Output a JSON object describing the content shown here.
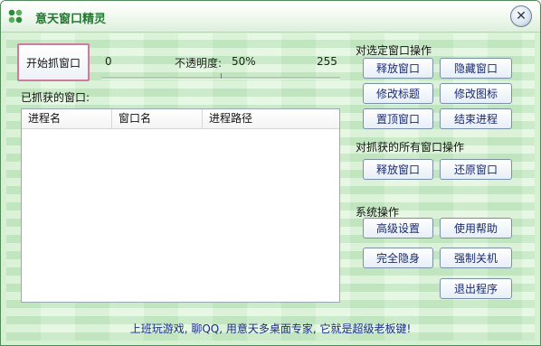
{
  "window": {
    "title": "意天窗口精灵",
    "close_glyph": "✕"
  },
  "capture": {
    "start_button": "开始抓窗口"
  },
  "opacity": {
    "min": "0",
    "label": "不透明度:",
    "value": "50%",
    "max": "255",
    "fraction": 0.5
  },
  "captured": {
    "label": "已抓获的窗口:",
    "columns": [
      "进程名",
      "窗口名",
      "进程路径"
    ],
    "rows": []
  },
  "selected_ops": {
    "heading": "对选定窗口操作",
    "release": "释放窗口",
    "hide": "隐藏窗口",
    "edit_title": "修改标题",
    "edit_icon": "修改图标",
    "top": "置顶窗口",
    "end_process": "结束进程"
  },
  "all_ops": {
    "heading": "对抓获的所有窗口操作",
    "release": "释放窗口",
    "restore": "还原窗口"
  },
  "system_ops": {
    "heading": "系统操作",
    "advanced": "高级设置",
    "help": "使用帮助",
    "stealth": "完全隐身",
    "shutdown": "强制关机",
    "exit": "退出程序"
  },
  "status_text": "上班玩游戏, 聊QQ, 用意天多桌面专家, 它就是超级老板键!"
}
